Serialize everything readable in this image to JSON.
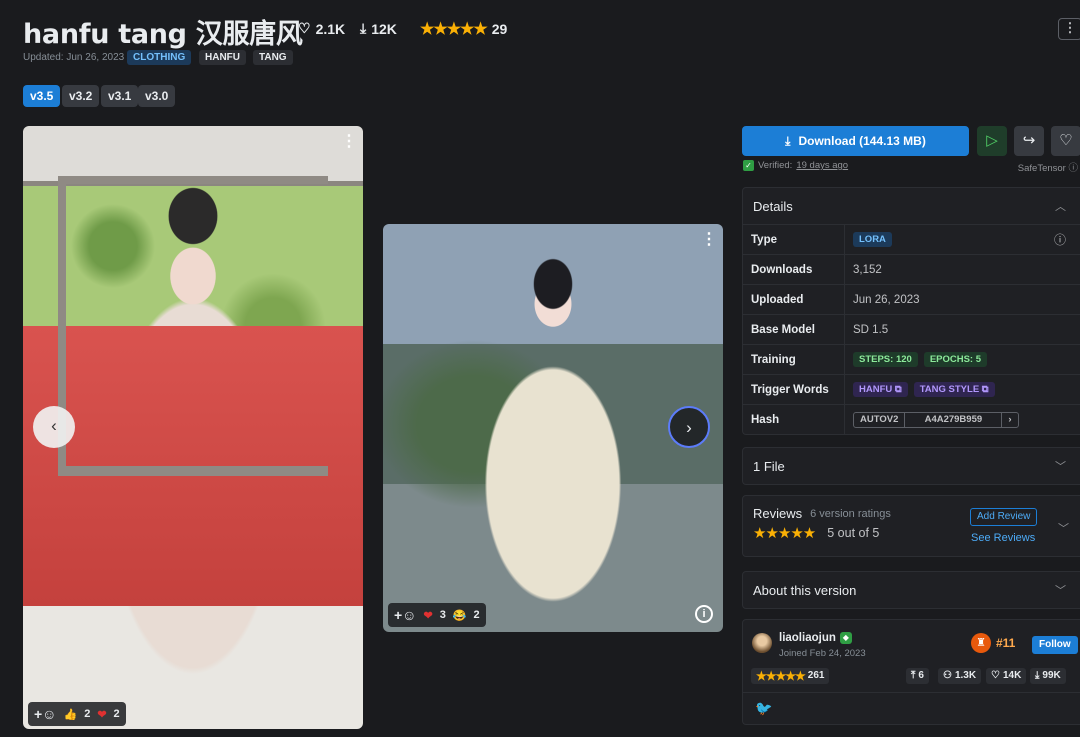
{
  "header": {
    "title": "hanfu tang 汉服唐风",
    "likes": "2.1K",
    "downloads": "12K",
    "rating_count": "29",
    "stars": "★★★★★",
    "updated": "Updated: Jun 26, 2023",
    "tags": [
      "CLOTHING",
      "HANFU",
      "TANG"
    ],
    "menu_icon": "⋮"
  },
  "versions": [
    "v3.5",
    "v3.2",
    "v3.1",
    "v3.0"
  ],
  "gallery": {
    "image1_reactions": {
      "add": "+",
      "thumbs": "2",
      "hearts": "2"
    },
    "image2_reactions": {
      "add": "+",
      "hearts": "3",
      "laugh": "2"
    }
  },
  "actions": {
    "download_label": "Download (144.13 MB)",
    "verified_label": "Verified:",
    "verified_ago": "19 days ago",
    "safetensor_label": "SafeTensor"
  },
  "details": {
    "heading": "Details",
    "type_label": "Type",
    "type_value": "LORA",
    "downloads_label": "Downloads",
    "downloads_value": "3,152",
    "uploaded_label": "Uploaded",
    "uploaded_value": "Jun 26, 2023",
    "base_model_label": "Base Model",
    "base_model_value": "SD 1.5",
    "training_label": "Training",
    "training_steps": "STEPS: 120",
    "training_epochs": "EPOCHS: 5",
    "trigger_label": "Trigger Words",
    "trigger_1": "HANFU",
    "trigger_2": "TANG STYLE",
    "hash_label": "Hash",
    "hash_type": "AUTOV2",
    "hash_value": "A4A279B959"
  },
  "files": {
    "heading": "1 File"
  },
  "reviews": {
    "heading": "Reviews",
    "sub": "6 version ratings",
    "stars": "★★★★★",
    "score": "5 out of 5",
    "add_review": "Add Review",
    "see_reviews": "See Reviews"
  },
  "about": {
    "heading": "About this version"
  },
  "creator": {
    "name": "liaoliaojun",
    "joined": "Joined Feb 24, 2023",
    "rank": "#11",
    "follow": "Follow",
    "stars": "★★★★★",
    "rating_count": "261",
    "uploads": "6",
    "followers": "1.3K",
    "likes": "14K",
    "downloads": "99K"
  },
  "colors": {
    "accent": "#1c7ed6",
    "background": "#1a1b1e",
    "star": "#fab005"
  }
}
